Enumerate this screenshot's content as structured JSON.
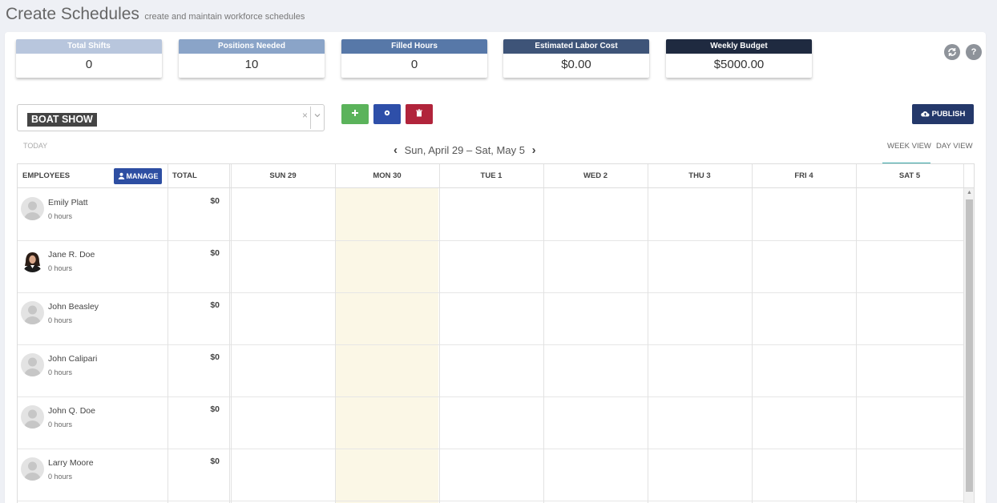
{
  "header": {
    "title": "Create Schedules",
    "subtitle": "create and maintain workforce schedules"
  },
  "stats": [
    {
      "label": "Total Shifts",
      "value": "0",
      "color": "#b8c6dd"
    },
    {
      "label": "Positions Needed",
      "value": "10",
      "color": "#8aa4c8"
    },
    {
      "label": "Filled Hours",
      "value": "0",
      "color": "#5778a8"
    },
    {
      "label": "Estimated Labor Cost",
      "value": "$0.00",
      "color": "#3e5478"
    },
    {
      "label": "Weekly Budget",
      "value": "$5000.00",
      "color": "#1f2a40"
    }
  ],
  "toolbar": {
    "refresh_icon": "refresh-icon",
    "help_icon": "question-icon",
    "location_select": {
      "selected": "BOAT SHOW",
      "clear": "×"
    },
    "add_color": "#5bb35b",
    "settings_color": "#2e4fa9",
    "delete_color": "#b1243b",
    "publish_label": "PUBLISH"
  },
  "nav": {
    "today_label": "TODAY",
    "date_range": "Sun, April 29 – Sat, May 5",
    "week_view": "WEEK VIEW",
    "day_view": "DAY VIEW"
  },
  "grid": {
    "employees_header": "EMPLOYEES",
    "manage_label": "MANAGE",
    "total_header": "TOTAL",
    "days": [
      "SUN 29",
      "MON 30",
      "TUE 1",
      "WED 2",
      "THU 3",
      "FRI 4",
      "SAT 5"
    ],
    "employees": [
      {
        "name": "Emily Platt",
        "hours": "0 hours",
        "total": "$0",
        "photo": false
      },
      {
        "name": "Jane R. Doe",
        "hours": "0 hours",
        "total": "$0",
        "photo": true
      },
      {
        "name": "John Beasley",
        "hours": "0 hours",
        "total": "$0",
        "photo": false
      },
      {
        "name": "John Calipari",
        "hours": "0 hours",
        "total": "$0",
        "photo": false
      },
      {
        "name": "John Q. Doe",
        "hours": "0 hours",
        "total": "$0",
        "photo": false
      },
      {
        "name": "Larry Moore",
        "hours": "0 hours",
        "total": "$0",
        "photo": false
      }
    ]
  }
}
